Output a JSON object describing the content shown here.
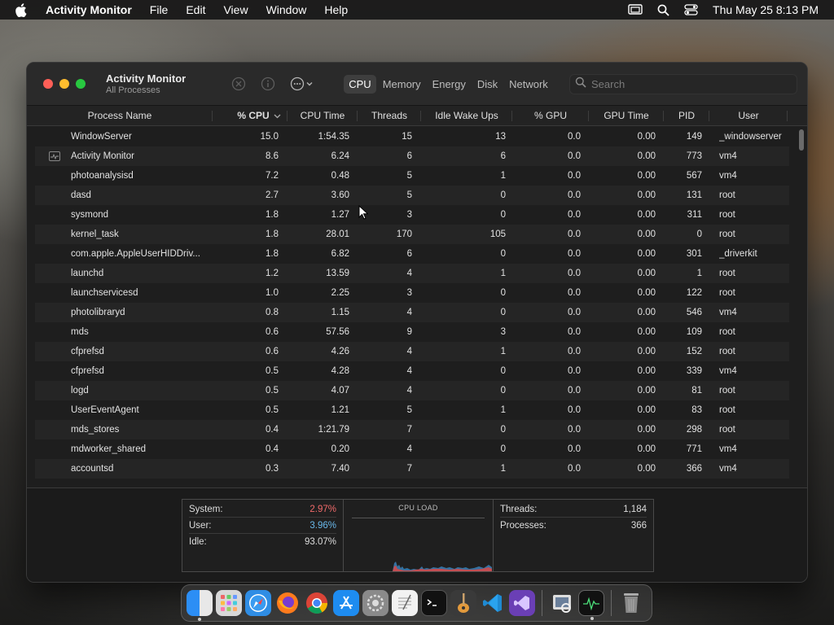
{
  "menubar": {
    "app_name": "Activity Monitor",
    "menus": [
      "File",
      "Edit",
      "View",
      "Window",
      "Help"
    ],
    "datetime": "Thu May 25  8:13 PM"
  },
  "window": {
    "title": "Activity Monitor",
    "subtitle": "All Processes",
    "tabs": [
      "CPU",
      "Memory",
      "Energy",
      "Disk",
      "Network"
    ],
    "active_tab": "CPU",
    "search_placeholder": "Search"
  },
  "table": {
    "columns": [
      "Process Name",
      "% CPU",
      "CPU Time",
      "Threads",
      "Idle Wake Ups",
      "% GPU",
      "GPU Time",
      "PID",
      "User"
    ],
    "rows": [
      {
        "name": "WindowServer",
        "cpu": "15.0",
        "time": "1:54.35",
        "threads": "15",
        "idle": "13",
        "gpu": "0.0",
        "gtime": "0.00",
        "pid": "149",
        "user": "_windowserver"
      },
      {
        "name": "Activity Monitor",
        "cpu": "8.6",
        "time": "6.24",
        "threads": "6",
        "idle": "6",
        "gpu": "0.0",
        "gtime": "0.00",
        "pid": "773",
        "user": "vm4"
      },
      {
        "name": "photoanalysisd",
        "cpu": "7.2",
        "time": "0.48",
        "threads": "5",
        "idle": "1",
        "gpu": "0.0",
        "gtime": "0.00",
        "pid": "567",
        "user": "vm4"
      },
      {
        "name": "dasd",
        "cpu": "2.7",
        "time": "3.60",
        "threads": "5",
        "idle": "0",
        "gpu": "0.0",
        "gtime": "0.00",
        "pid": "131",
        "user": "root"
      },
      {
        "name": "sysmond",
        "cpu": "1.8",
        "time": "1.27",
        "threads": "3",
        "idle": "0",
        "gpu": "0.0",
        "gtime": "0.00",
        "pid": "311",
        "user": "root"
      },
      {
        "name": "kernel_task",
        "cpu": "1.8",
        "time": "28.01",
        "threads": "170",
        "idle": "105",
        "gpu": "0.0",
        "gtime": "0.00",
        "pid": "0",
        "user": "root"
      },
      {
        "name": "com.apple.AppleUserHIDDriv...",
        "cpu": "1.8",
        "time": "6.82",
        "threads": "6",
        "idle": "0",
        "gpu": "0.0",
        "gtime": "0.00",
        "pid": "301",
        "user": "_driverkit"
      },
      {
        "name": "launchd",
        "cpu": "1.2",
        "time": "13.59",
        "threads": "4",
        "idle": "1",
        "gpu": "0.0",
        "gtime": "0.00",
        "pid": "1",
        "user": "root"
      },
      {
        "name": "launchservicesd",
        "cpu": "1.0",
        "time": "2.25",
        "threads": "3",
        "idle": "0",
        "gpu": "0.0",
        "gtime": "0.00",
        "pid": "122",
        "user": "root"
      },
      {
        "name": "photolibraryd",
        "cpu": "0.8",
        "time": "1.15",
        "threads": "4",
        "idle": "0",
        "gpu": "0.0",
        "gtime": "0.00",
        "pid": "546",
        "user": "vm4"
      },
      {
        "name": "mds",
        "cpu": "0.6",
        "time": "57.56",
        "threads": "9",
        "idle": "3",
        "gpu": "0.0",
        "gtime": "0.00",
        "pid": "109",
        "user": "root"
      },
      {
        "name": "cfprefsd",
        "cpu": "0.6",
        "time": "4.26",
        "threads": "4",
        "idle": "1",
        "gpu": "0.0",
        "gtime": "0.00",
        "pid": "152",
        "user": "root"
      },
      {
        "name": "cfprefsd",
        "cpu": "0.5",
        "time": "4.28",
        "threads": "4",
        "idle": "0",
        "gpu": "0.0",
        "gtime": "0.00",
        "pid": "339",
        "user": "vm4"
      },
      {
        "name": "logd",
        "cpu": "0.5",
        "time": "4.07",
        "threads": "4",
        "idle": "0",
        "gpu": "0.0",
        "gtime": "0.00",
        "pid": "81",
        "user": "root"
      },
      {
        "name": "UserEventAgent",
        "cpu": "0.5",
        "time": "1.21",
        "threads": "5",
        "idle": "1",
        "gpu": "0.0",
        "gtime": "0.00",
        "pid": "83",
        "user": "root"
      },
      {
        "name": "mds_stores",
        "cpu": "0.4",
        "time": "1:21.79",
        "threads": "7",
        "idle": "0",
        "gpu": "0.0",
        "gtime": "0.00",
        "pid": "298",
        "user": "root"
      },
      {
        "name": "mdworker_shared",
        "cpu": "0.4",
        "time": "0.20",
        "threads": "4",
        "idle": "0",
        "gpu": "0.0",
        "gtime": "0.00",
        "pid": "771",
        "user": "vm4"
      },
      {
        "name": "accountsd",
        "cpu": "0.3",
        "time": "7.40",
        "threads": "7",
        "idle": "1",
        "gpu": "0.0",
        "gtime": "0.00",
        "pid": "366",
        "user": "vm4"
      }
    ]
  },
  "summary": {
    "system_label": "System:",
    "system_value": "2.97%",
    "user_label": "User:",
    "user_value": "3.96%",
    "idle_label": "Idle:",
    "idle_value": "93.07%",
    "load_title": "CPU LOAD",
    "threads_label": "Threads:",
    "threads_value": "1,184",
    "processes_label": "Processes:",
    "processes_value": "366"
  },
  "dock": {
    "apps": [
      "finder-icon",
      "launchpad-icon",
      "safari-icon",
      "firefox-icon",
      "chrome-icon",
      "app-store-icon",
      "system-settings-icon",
      "textedit-icon",
      "terminal-icon",
      "garageband-icon",
      "vscode-icon",
      "visual-studio-icon",
      "preview-icon",
      "activity-monitor-icon",
      "trash-icon"
    ]
  }
}
